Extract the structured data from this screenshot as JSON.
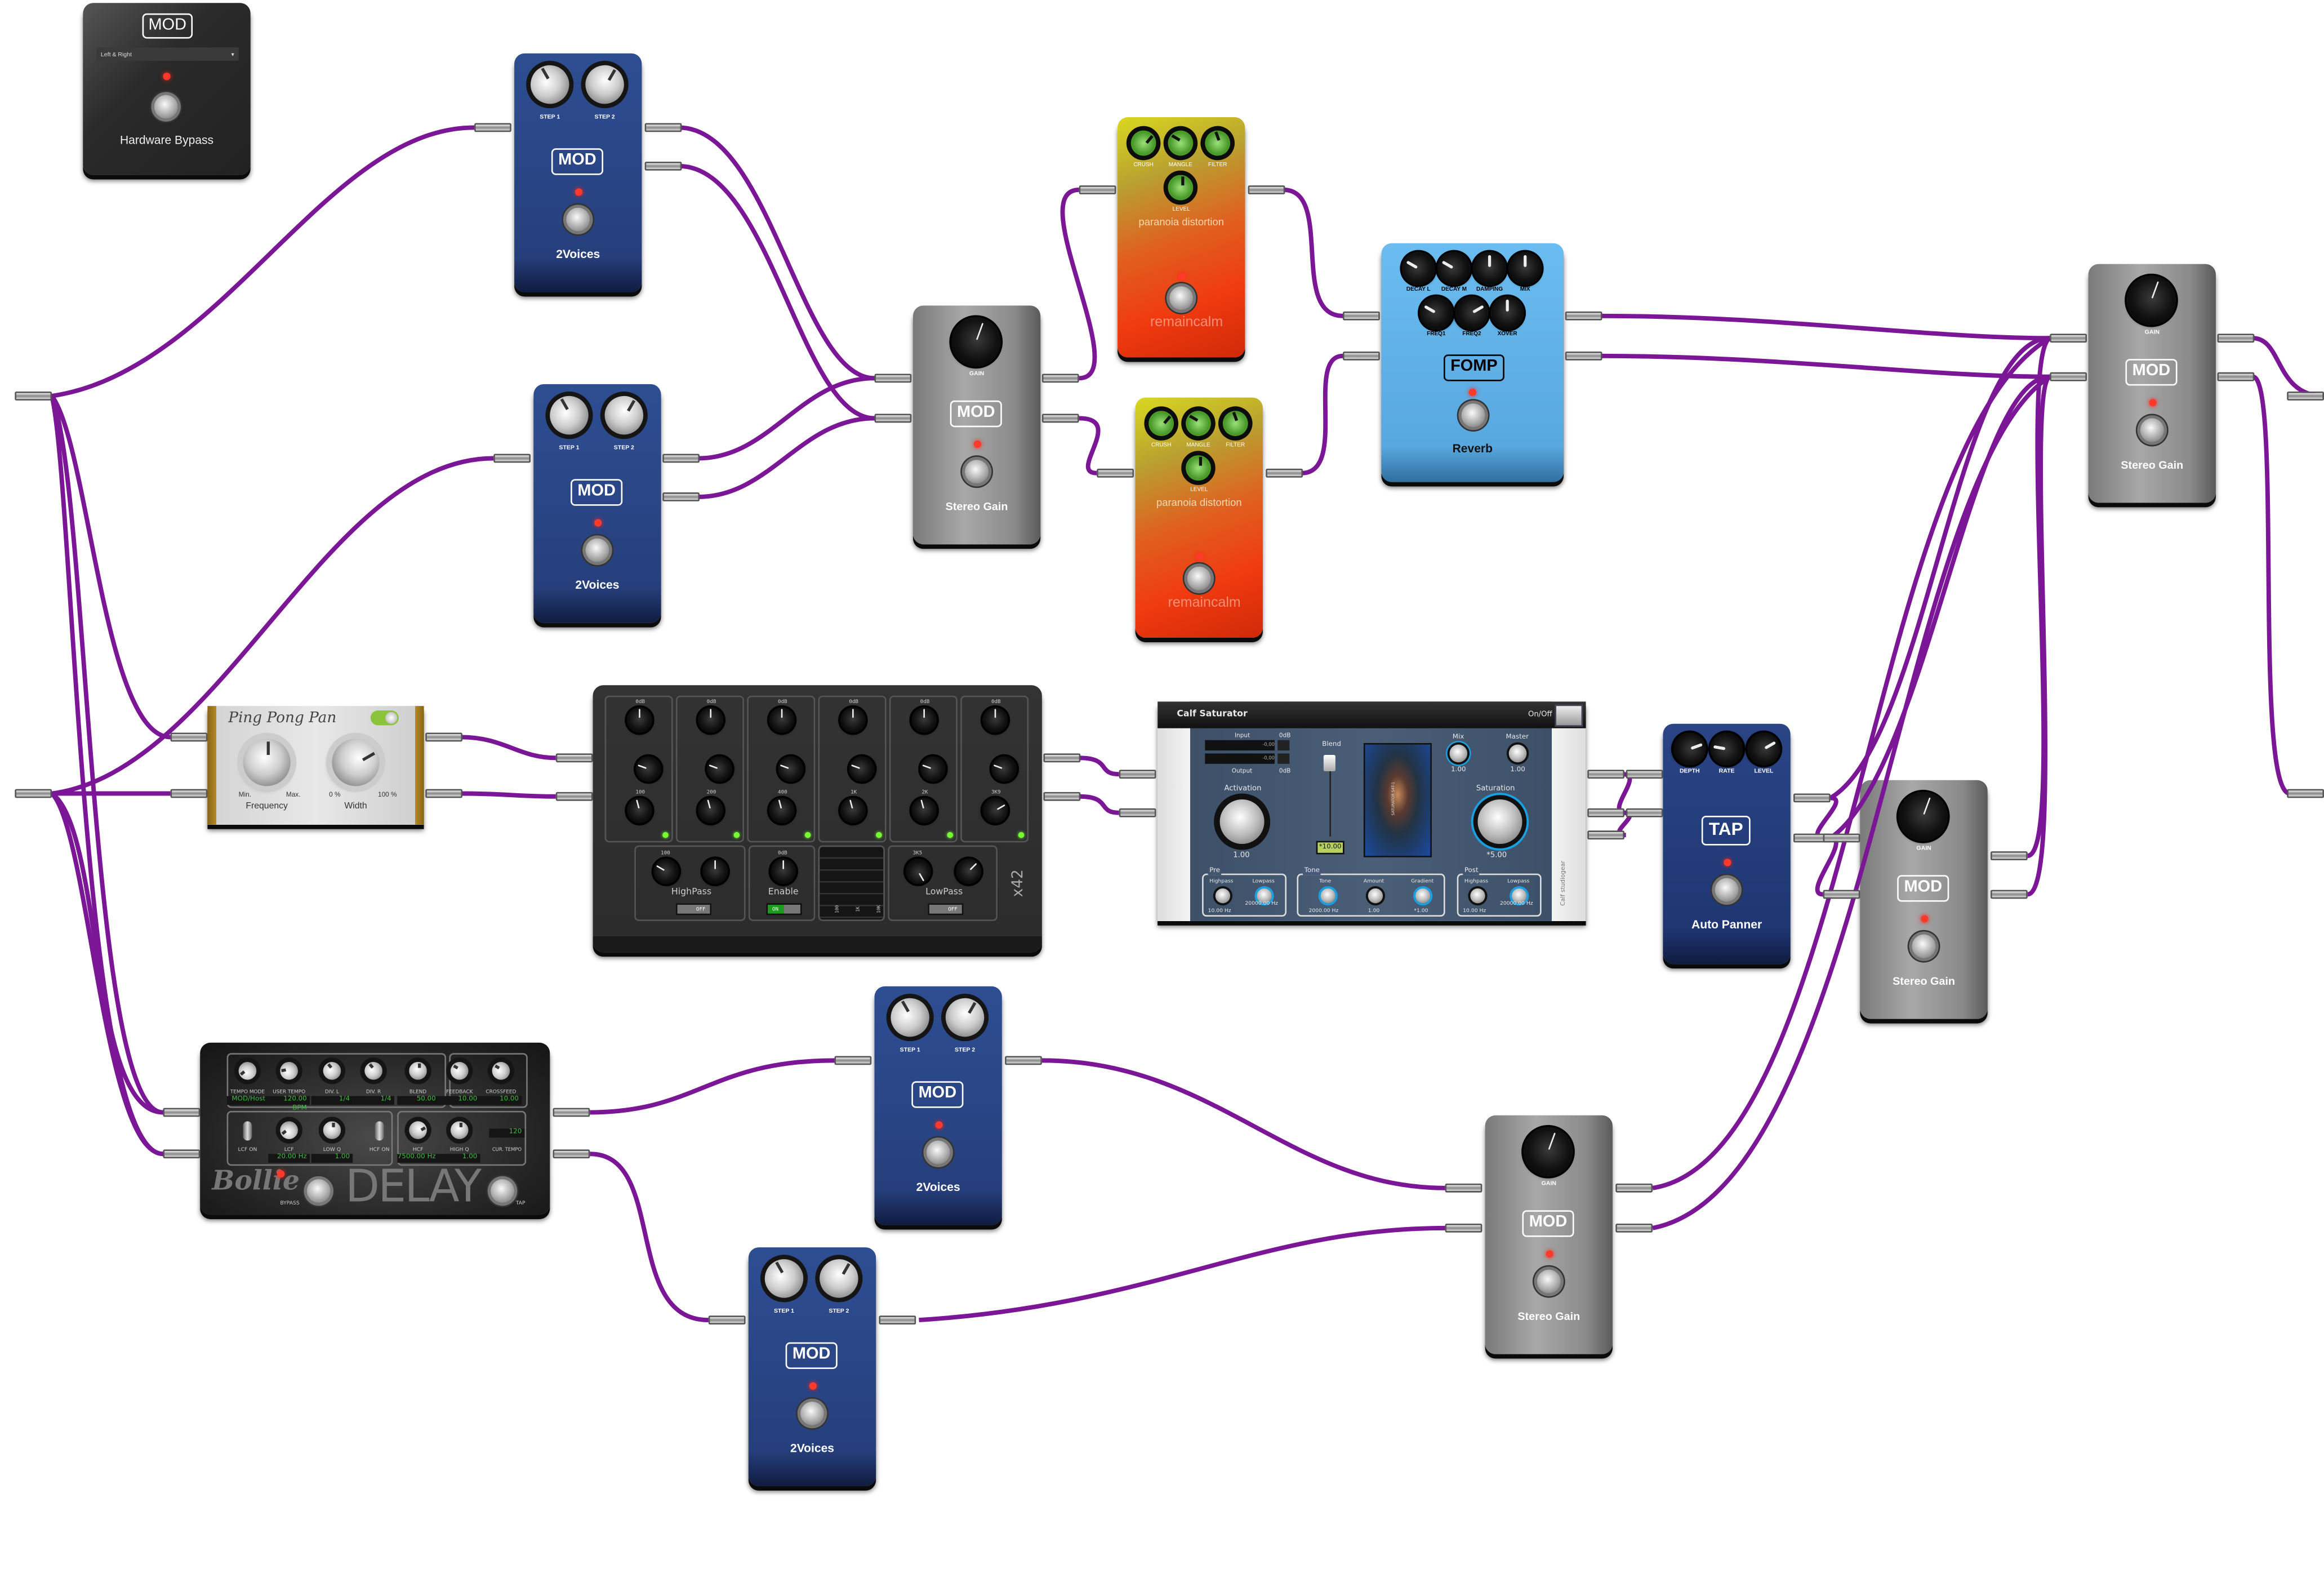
{
  "colors": {
    "cable": "#7b1796",
    "mod_blue": "#2b4a8a",
    "fomp_blue": "#5fb0e6",
    "tap_navy": "#213a78",
    "gain_grey": "#8a8a8a",
    "led": "#ff3a2a"
  },
  "hardware_bypass": {
    "logo": "MOD",
    "select_value": "Left & Right",
    "name": "Hardware Bypass"
  },
  "two_voices": {
    "knob1": "STEP 1",
    "knob2": "STEP 2",
    "logo": "MOD",
    "name": "2Voices"
  },
  "stereo_gain": {
    "knob": "GAIN",
    "logo": "MOD",
    "name": "Stereo Gain"
  },
  "paranoia": {
    "knobs": [
      "CRUSH",
      "MANGLE",
      "FILTER"
    ],
    "knob4": "LEVEL",
    "title": "paranoia distortion",
    "brand": "remaincalm"
  },
  "fomp": {
    "knobs": [
      "DECAY L",
      "DECAY M",
      "DAMPING",
      "MIX",
      "FREQ1",
      "FREQ2",
      "XOVER"
    ],
    "logo": "FOMP",
    "name": "Reverb"
  },
  "tap": {
    "knobs": [
      "DEPTH",
      "RATE",
      "LEVEL"
    ],
    "logo": "TAP",
    "name": "Auto Panner"
  },
  "ping_pong": {
    "title": "Ping Pong Pan",
    "freq_min": "Min.",
    "freq_max": "Max.",
    "freq_label": "Frequency",
    "width_min": "0 %",
    "width_max": "100 %",
    "width_label": "Width"
  },
  "x42": {
    "gain_top": "0dB",
    "band_freqs": [
      "100",
      "200",
      "400",
      "1K",
      "2K",
      "3K9"
    ],
    "highpass": "HighPass",
    "highpass_freq": "100",
    "highpass_state": "OFF",
    "enable": "Enable",
    "enable_gain": "0dB",
    "enable_state": "ON",
    "lowpass": "LowPass",
    "lowpass_freq": "3K5",
    "lowpass_state": "OFF",
    "graph_ticks": [
      "100",
      "1K",
      "10K"
    ],
    "brand": "x42"
  },
  "calf": {
    "title": "Calf Saturator",
    "onoff": "On/Off",
    "input": "Input",
    "output": "Output",
    "in_db": "0dB",
    "out_db": "0dB",
    "in_meter": "-0,00",
    "out_meter": "-0,00",
    "blend": "Blend",
    "blend_value": "*10.00",
    "mix": "Mix",
    "mix_value": "1.00",
    "master": "Master",
    "master_value": "1.00",
    "activation": "Activation",
    "activation_value": "1.00",
    "saturation": "Saturation",
    "saturation_value": "*5.00",
    "pre": {
      "label": "Pre",
      "highpass": "Highpass",
      "highpass_value": "10.00 Hz",
      "lowpass": "Lowpass",
      "lowpass_value": "20000.00 Hz"
    },
    "tone": {
      "label": "Tone",
      "tone": "Tone",
      "tone_value": "2000.00 Hz",
      "amount": "Amount",
      "amount_value": "1.00",
      "gradient": "Gradient",
      "gradient_value": "*1.00"
    },
    "post": {
      "label": "Post",
      "highpass": "Highpass",
      "highpass_value": "10.00 Hz",
      "lowpass": "Lowpass",
      "lowpass_value": "20000.00 Hz"
    },
    "tube_text": "SATURATOR S4T-1",
    "brand": "Calf studiogear"
  },
  "bollie": {
    "top": [
      {
        "label": "TEMPO MODE",
        "value": "MOD/Host"
      },
      {
        "label": "USER TEMPO",
        "value": "120.00 BPM"
      },
      {
        "label": "DIV. L",
        "value": "1/4"
      },
      {
        "label": "DIV. R",
        "value": "1/4"
      },
      {
        "label": "BLEND",
        "value": "50.00"
      },
      {
        "label": "FEEDBACK",
        "value": "10.00"
      },
      {
        "label": "CROSSFEED",
        "value": "10.00"
      }
    ],
    "lcf_on": "LCF ON",
    "lcf": "LCF",
    "lcf_value": "20.00 Hz",
    "low_q": "LOW Q",
    "low_q_value": "1.00",
    "hcf_on": "HCF ON",
    "hcf": "HCF",
    "hcf_value": "7500.00 Hz",
    "high_q": "HIGH Q",
    "high_q_value": "1.00",
    "cur_tempo": "CUR. TEMPO",
    "cur_tempo_value": "120",
    "brand": "Bollie",
    "title": "DELAY",
    "bypass": "BYPASS",
    "tap": "TAP"
  }
}
